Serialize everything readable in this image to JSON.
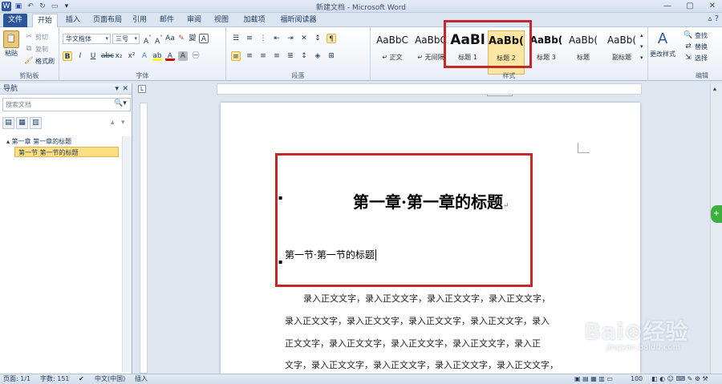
{
  "window": {
    "title": "新建文档 - Microsoft Word"
  },
  "tabs": [
    {
      "label": "文件"
    },
    {
      "label": "开始"
    },
    {
      "label": "插入"
    },
    {
      "label": "页面布局"
    },
    {
      "label": "引用"
    },
    {
      "label": "邮件"
    },
    {
      "label": "审阅"
    },
    {
      "label": "视图"
    },
    {
      "label": "加载项"
    },
    {
      "label": "福昕阅读器"
    }
  ],
  "clipboard": {
    "paste": "粘贴",
    "cut": "剪切",
    "copy": "复制",
    "format_painter": "格式刷",
    "group": "剪贴板"
  },
  "font": {
    "name": "华文楷体",
    "size": "三号",
    "group": "字体"
  },
  "paragraph": {
    "group": "段落"
  },
  "styles": {
    "group": "样式",
    "items": [
      {
        "sample": "AaBbC",
        "name": "↵ 正文"
      },
      {
        "sample": "AaBbC",
        "name": "↵ 无间隔"
      },
      {
        "sample": "AaBl",
        "name": "标题 1"
      },
      {
        "sample": "AaBb(",
        "name": "标题 2"
      },
      {
        "sample": "AaBb(",
        "name": "标题 3"
      },
      {
        "sample": "AaBb(",
        "name": "标题"
      },
      {
        "sample": "AaBb(",
        "name": "副标题"
      }
    ],
    "change_styles": "更改样式",
    "tooltip": "标题 2"
  },
  "editing": {
    "find": "查找",
    "replace": "替换",
    "select": "选择",
    "group": "编辑"
  },
  "navigation": {
    "title": "导航",
    "search_placeholder": "搜索文档",
    "items": [
      {
        "label": "▴ 第一章 第一章的标题"
      },
      {
        "label": "第一节 第一节的标题"
      }
    ]
  },
  "document": {
    "heading1": "第一章·第一章的标题",
    "heading2": "第一节·第一节的标题",
    "body_lines": [
      "录入正文文字，录入正文文字，录入正文文字，录入正文文字，",
      "录入正文文字，录入正文文字，录入正文文字，录入正文文字，录入",
      "正文文字，录入正文文字，录入正文文字，录入正文文字，录入正",
      "文字，录入正文文字，录入正文文字，录入正文文字，录入正文文字，"
    ]
  },
  "status": {
    "page": "页面: 1/1",
    "words": "字数: 151",
    "language": "中文(中国)",
    "mode": "插入",
    "zoom": "100"
  },
  "watermark": {
    "brand": "Bai⊛经验",
    "url": "jingyan.baidu.com"
  },
  "colors": {
    "accent": "#2b579a",
    "highlight": "#c62828",
    "selected": "#fddf83"
  }
}
